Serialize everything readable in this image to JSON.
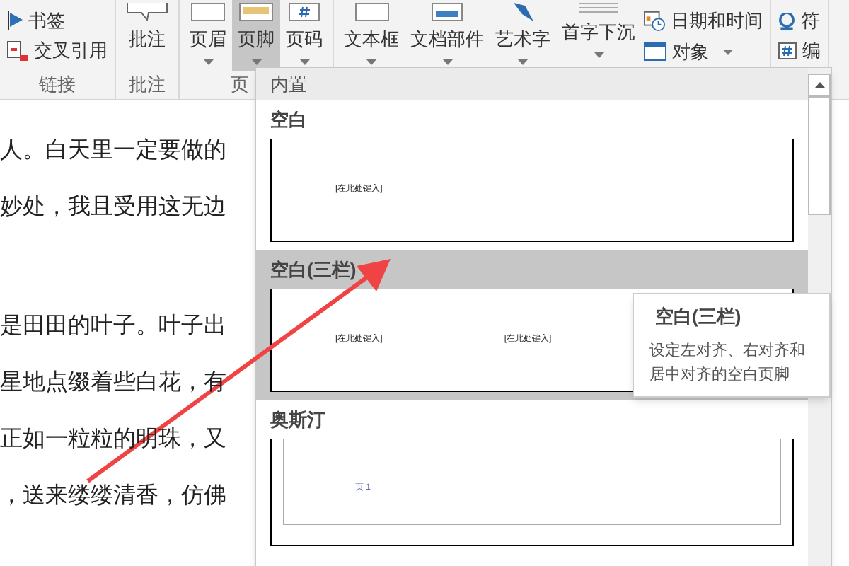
{
  "ribbon": {
    "groups": [
      {
        "label": "链接",
        "buttons": [
          {
            "kind": "small",
            "label": "书签",
            "selected": false
          },
          {
            "kind": "small",
            "label": "交叉引用",
            "selected": false
          }
        ]
      },
      {
        "label": "批注",
        "buttons": [
          {
            "kind": "large",
            "label": "批注",
            "selected": false
          }
        ]
      },
      {
        "label": "页",
        "buttons": [
          {
            "kind": "menu",
            "label": "页眉",
            "selected": false
          },
          {
            "kind": "menu",
            "label": "页脚",
            "selected": true
          },
          {
            "kind": "menu",
            "label": "页码",
            "selected": false
          }
        ]
      },
      {
        "buttons": [
          {
            "kind": "menu",
            "label": "文本框",
            "selected": false
          },
          {
            "kind": "menu",
            "label": "文档部件",
            "selected": false
          },
          {
            "kind": "menu",
            "label": "艺术字",
            "selected": false
          },
          {
            "kind": "menu",
            "label": "首字下沉",
            "selected": false
          },
          {
            "kind": "small",
            "label": "日期和时间",
            "selected": false
          },
          {
            "kind": "small-menu",
            "label": "对象",
            "selected": false
          }
        ]
      },
      {
        "buttons": [
          {
            "kind": "small",
            "label": "符",
            "selected": false
          },
          {
            "kind": "small",
            "label": "编",
            "selected": false
          }
        ]
      }
    ]
  },
  "document": {
    "paragraphs": [
      {
        "lines": [
          "人。白天里一定要做的",
          "妙处，我且受用这无边"
        ]
      },
      {
        "lines": [
          "是田田的叶子。叶子出",
          "星地点缀着些白花，有",
          "正如一粒粒的明珠，又",
          "，送来缕缕清香，仿佛"
        ]
      }
    ]
  },
  "gallery": {
    "header": "内置",
    "items": [
      {
        "kind": "blank",
        "title": "空白",
        "selected": false,
        "placeholders": [
          "[在此处键入]"
        ]
      },
      {
        "kind": "three",
        "title": "空白(三栏)",
        "selected": true,
        "placeholders": [
          "[在此处键入]",
          "[在此处键入]"
        ]
      },
      {
        "kind": "austin",
        "title": "奥斯汀",
        "selected": false,
        "placeholders": [
          "页 1"
        ]
      }
    ]
  },
  "tooltip": {
    "title": "空白(三栏)",
    "description": "设定左对齐、右对齐和居中对齐的空白页脚"
  }
}
